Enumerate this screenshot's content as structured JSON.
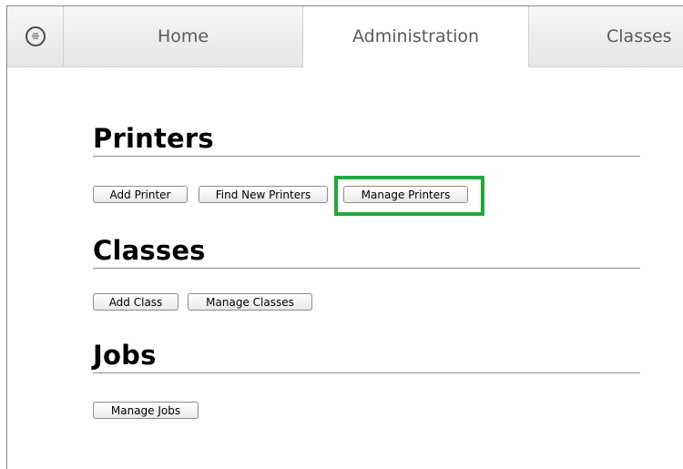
{
  "tabs": {
    "home": "Home",
    "administration": "Administration",
    "classes": "Classes"
  },
  "sections": {
    "printers": {
      "title": "Printers",
      "add": "Add Printer",
      "find": "Find New Printers",
      "manage": "Manage Printers"
    },
    "classes": {
      "title": "Classes",
      "add": "Add Class",
      "manage": "Manage Classes"
    },
    "jobs": {
      "title": "Jobs",
      "manage": "Manage Jobs"
    }
  },
  "colors": {
    "highlight": "#22a83a"
  }
}
